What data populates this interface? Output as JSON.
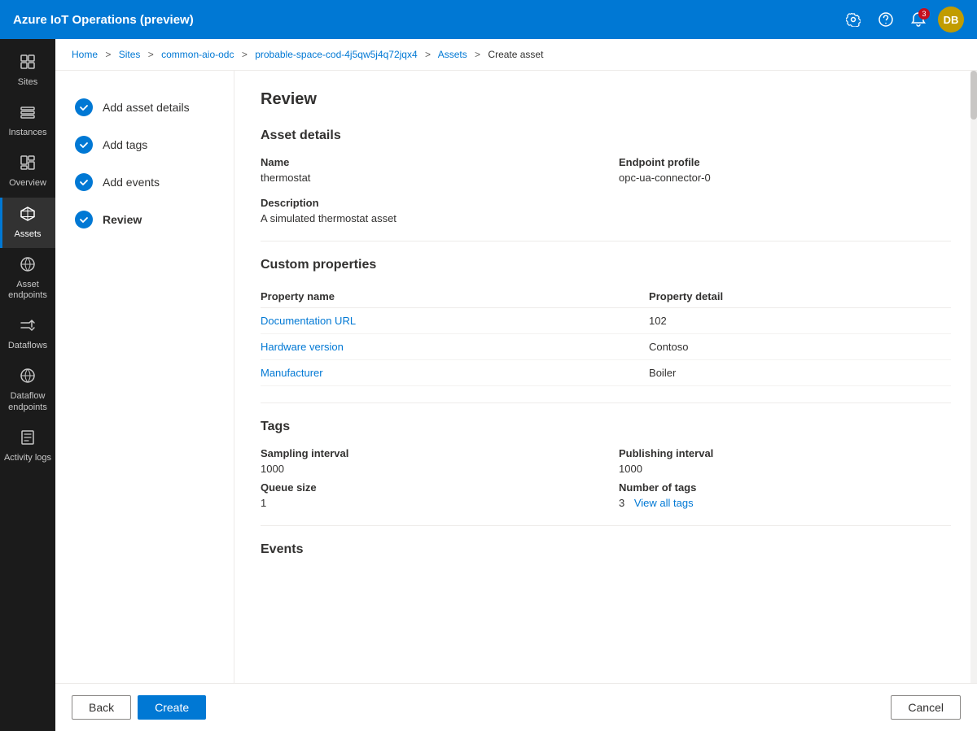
{
  "app": {
    "title": "Azure IoT Operations (preview)"
  },
  "topNav": {
    "title": "Azure IoT Operations (preview)",
    "icons": {
      "settings": "⚙",
      "help": "?",
      "notifications": "🔔",
      "notificationCount": "3",
      "userInitials": "DB"
    }
  },
  "breadcrumb": {
    "items": [
      "Home",
      "Sites",
      "common-aio-odc",
      "probable-space-cod-4j5qw5j4q72jqx4",
      "Assets"
    ],
    "current": "Create asset"
  },
  "sidebar": {
    "items": [
      {
        "id": "sites",
        "label": "Sites",
        "icon": "⊞"
      },
      {
        "id": "instances",
        "label": "Instances",
        "icon": "≡"
      },
      {
        "id": "overview",
        "label": "Overview",
        "icon": "◱"
      },
      {
        "id": "assets",
        "label": "Assets",
        "icon": "◈",
        "active": true
      },
      {
        "id": "asset-endpoints",
        "label": "Asset endpoints",
        "icon": "⬡"
      },
      {
        "id": "dataflows",
        "label": "Dataflows",
        "icon": "⇌"
      },
      {
        "id": "dataflow-endpoints",
        "label": "Dataflow endpoints",
        "icon": "⬡"
      },
      {
        "id": "activity-logs",
        "label": "Activity logs",
        "icon": "≣"
      }
    ]
  },
  "wizard": {
    "steps": [
      {
        "id": "add-asset-details",
        "label": "Add asset details",
        "state": "complete"
      },
      {
        "id": "add-tags",
        "label": "Add tags",
        "state": "complete"
      },
      {
        "id": "add-events",
        "label": "Add events",
        "state": "complete"
      },
      {
        "id": "review",
        "label": "Review",
        "state": "active"
      }
    ]
  },
  "review": {
    "title": "Review",
    "assetDetails": {
      "sectionTitle": "Asset details",
      "nameLabel": "Name",
      "nameValue": "thermostat",
      "endpointLabel": "Endpoint profile",
      "endpointValue": "opc-ua-connector-0",
      "descriptionLabel": "Description",
      "descriptionValue": "A simulated thermostat asset"
    },
    "customProperties": {
      "sectionTitle": "Custom properties",
      "columns": {
        "propertyName": "Property name",
        "propertyDetail": "Property detail"
      },
      "rows": [
        {
          "name": "Documentation URL",
          "detail": "102"
        },
        {
          "name": "Hardware version",
          "detail": "Contoso"
        },
        {
          "name": "Manufacturer",
          "detail": "Boiler"
        }
      ]
    },
    "tags": {
      "sectionTitle": "Tags",
      "samplingIntervalLabel": "Sampling interval",
      "samplingIntervalValue": "1000",
      "publishingIntervalLabel": "Publishing interval",
      "publishingIntervalValue": "1000",
      "queueSizeLabel": "Queue size",
      "queueSizeValue": "1",
      "numberOfTagsLabel": "Number of tags",
      "numberOfTagsValue": "3",
      "viewAllTagsLabel": "View all tags"
    },
    "events": {
      "sectionTitle": "Events"
    }
  },
  "bottomBar": {
    "backLabel": "Back",
    "createLabel": "Create",
    "cancelLabel": "Cancel"
  }
}
